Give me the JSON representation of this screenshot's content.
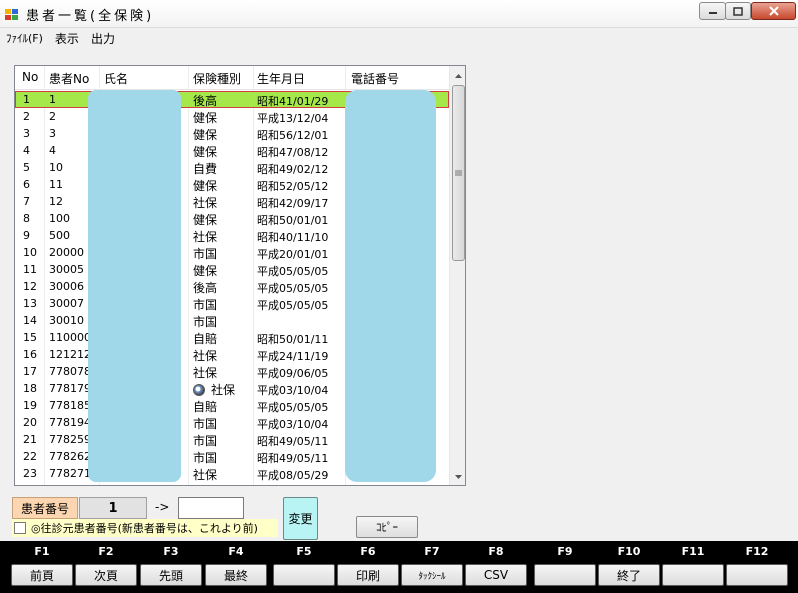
{
  "window": {
    "title": "患者一覧(全保険)",
    "accent_close": "#c7472c"
  },
  "menu": [
    {
      "label": "ﾌｧｲﾙ(F)"
    },
    {
      "label": "表示"
    },
    {
      "label": "出力"
    }
  ],
  "list": {
    "columns": [
      "No",
      "患者No",
      "氏名",
      "保険種別",
      "生年月日",
      "電話番号"
    ],
    "rows": [
      {
        "no": "1",
        "pno": "1",
        "ins": "後高",
        "dob": "昭和41/01/29",
        "selected": true
      },
      {
        "no": "2",
        "pno": "2",
        "ins": "健保",
        "dob": "平成13/12/04"
      },
      {
        "no": "3",
        "pno": "3",
        "ins": "健保",
        "dob": "昭和56/12/01"
      },
      {
        "no": "4",
        "pno": "4",
        "ins": "健保",
        "dob": "昭和47/08/12"
      },
      {
        "no": "5",
        "pno": "10",
        "ins": "自費",
        "dob": "昭和49/02/12"
      },
      {
        "no": "6",
        "pno": "11",
        "ins": "健保",
        "dob": "昭和52/05/12"
      },
      {
        "no": "7",
        "pno": "12",
        "ins": "社保",
        "dob": "昭和42/09/17"
      },
      {
        "no": "8",
        "pno": "100",
        "ins": "健保",
        "dob": "昭和50/01/01"
      },
      {
        "no": "9",
        "pno": "500",
        "ins": "社保",
        "dob": "昭和40/11/10"
      },
      {
        "no": "10",
        "pno": "20000",
        "ins": "市国",
        "dob": "平成20/01/01"
      },
      {
        "no": "11",
        "pno": "30005",
        "ins": "健保",
        "dob": "平成05/05/05"
      },
      {
        "no": "12",
        "pno": "30006",
        "ins": "後高",
        "dob": "平成05/05/05"
      },
      {
        "no": "13",
        "pno": "30007",
        "ins": "市国",
        "dob": "平成05/05/05"
      },
      {
        "no": "14",
        "pno": "30010",
        "ins": "市国",
        "dob": ""
      },
      {
        "no": "15",
        "pno": "110000",
        "ins": "自賠",
        "dob": "昭和50/01/11"
      },
      {
        "no": "16",
        "pno": "121212",
        "ins": "社保",
        "dob": "平成24/11/19"
      },
      {
        "no": "17",
        "pno": "778078",
        "ins": "社保",
        "dob": "平成09/06/05"
      },
      {
        "no": "18",
        "pno": "778179",
        "ins": "社保",
        "dob": "平成03/10/04",
        "icon": "insurance-card-icon"
      },
      {
        "no": "19",
        "pno": "778185",
        "ins": "自賠",
        "dob": "平成05/05/05"
      },
      {
        "no": "20",
        "pno": "778194",
        "ins": "市国",
        "dob": "平成03/10/04"
      },
      {
        "no": "21",
        "pno": "778259",
        "ins": "市国",
        "dob": "昭和49/05/11"
      },
      {
        "no": "22",
        "pno": "778262",
        "ins": "市国",
        "dob": "昭和49/05/11"
      },
      {
        "no": "23",
        "pno": "778271",
        "ins": "社保",
        "dob": "平成08/05/29"
      }
    ],
    "selected_color": "#a4e84a",
    "redaction_color": "#a0d8ea"
  },
  "controls": {
    "patient_no_label": "患者番号",
    "patient_no_value": "1",
    "arrow": "->",
    "new_patient_no": "",
    "checkbox_label": "◎往診元患者番号(新患者番号は、これより前)",
    "change_button": "変更",
    "copy_button": "ｺﾋﾟｰ"
  },
  "fkeys": [
    {
      "key": "F1",
      "label": "前頁"
    },
    {
      "key": "F2",
      "label": "次頁"
    },
    {
      "key": "F3",
      "label": "先頭"
    },
    {
      "key": "F4",
      "label": "最終"
    },
    {
      "key": "F5",
      "label": ""
    },
    {
      "key": "F6",
      "label": "印刷"
    },
    {
      "key": "F7",
      "label": "ﾀｯｸｼｰﾙ"
    },
    {
      "key": "F8",
      "label": "CSV"
    },
    {
      "key": "F9",
      "label": ""
    },
    {
      "key": "F10",
      "label": "終了"
    },
    {
      "key": "F11",
      "label": ""
    },
    {
      "key": "F12",
      "label": ""
    }
  ]
}
